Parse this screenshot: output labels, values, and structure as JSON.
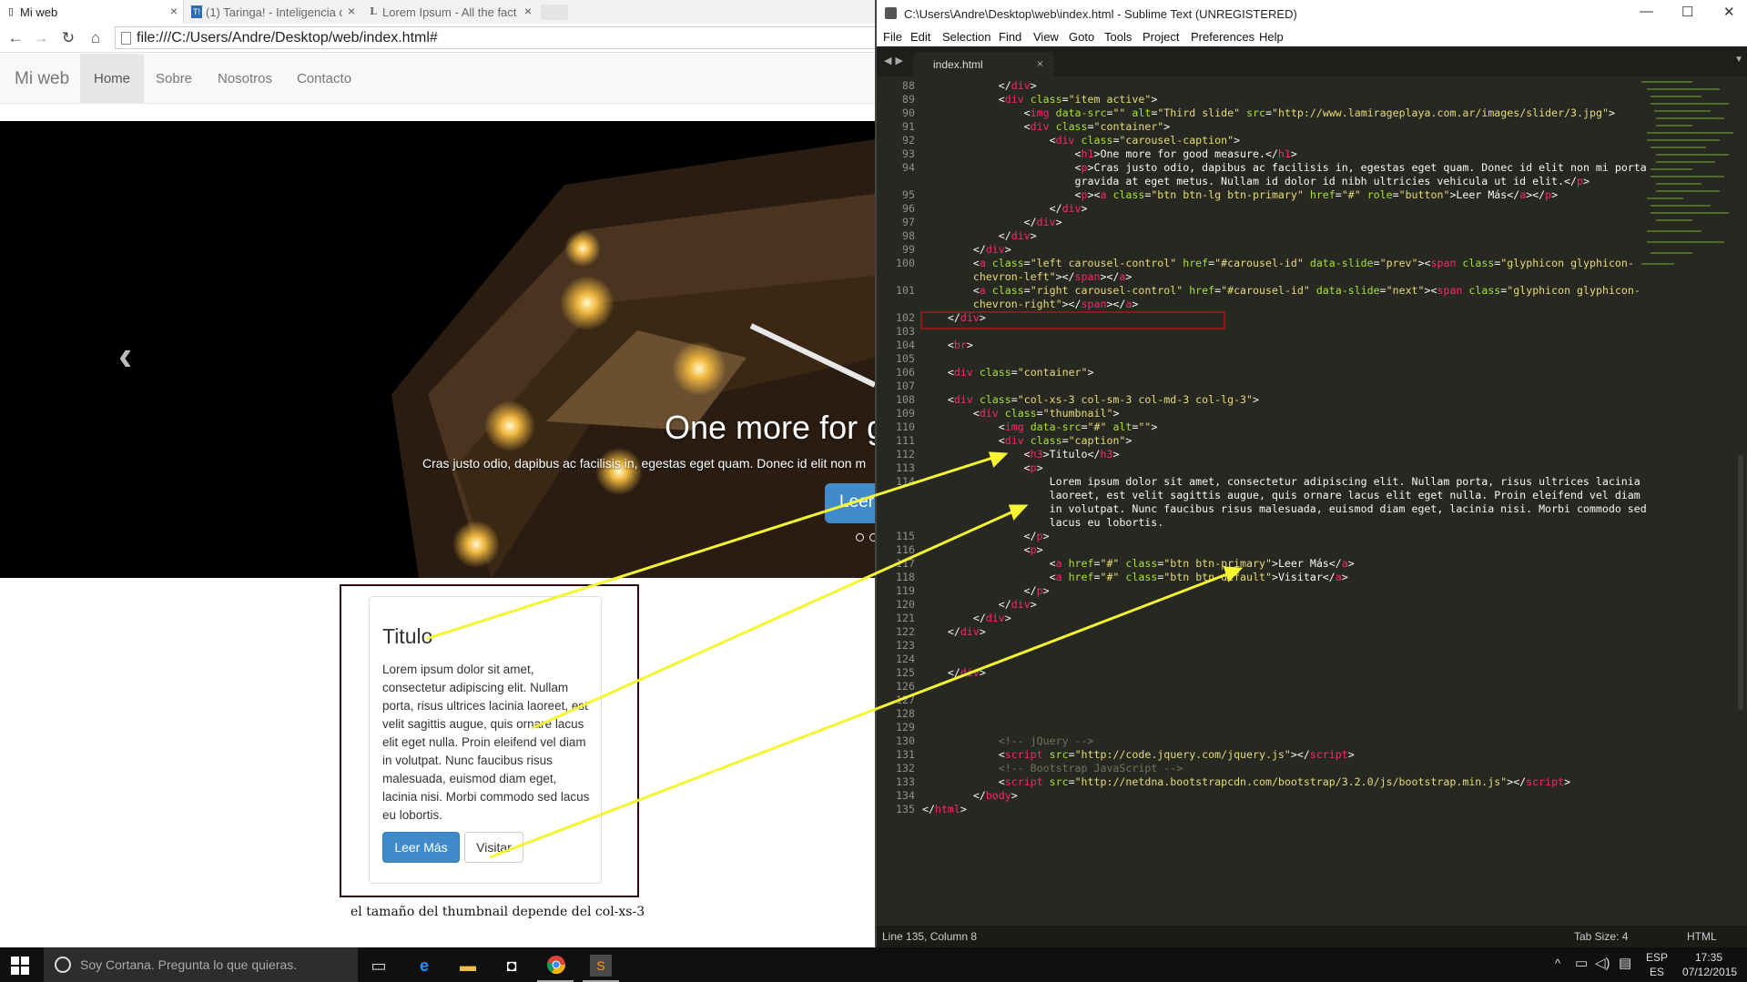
{
  "browser": {
    "tabs": [
      {
        "title": "Mi web",
        "active": true
      },
      {
        "title": "(1) Taringa! - Inteligencia c",
        "active": false
      },
      {
        "title": "Lorem Ipsum - All the fact",
        "active": false
      }
    ],
    "url": "file:///C:/Users/Andre/Desktop/web/index.html#",
    "navbar": {
      "brand": "Mi web",
      "links": [
        "Home",
        "Sobre",
        "Nosotros",
        "Contacto"
      ]
    },
    "carousel": {
      "caption_title": "One more for g",
      "caption_text": "Cras justo odio, dapibus ac facilisis in, egestas eget quam. Donec id elit non m",
      "button_label": "Leer"
    },
    "thumbnail": {
      "title": "Titulo",
      "text": "Lorem ipsum dolor sit amet, consectetur adipiscing elit. Nullam porta, risus ultrices lacinia laoreet, est velit sagittis augue, quis ornare lacus elit eget nulla. Proin eleifend vel diam in volutpat. Nunc faucibus risus malesuada, euismod diam eget, lacinia nisi. Morbi commodo sed lacus eu lobortis.",
      "btn_primary": "Leer Más",
      "btn_default": "Visitar"
    },
    "note": "el tamaño del thumbnail depende del col-xs-3"
  },
  "sublime": {
    "title": "C:\\Users\\Andre\\Desktop\\web\\index.html - Sublime Text (UNREGISTERED)",
    "menu": [
      "File",
      "Edit",
      "Selection",
      "Find",
      "View",
      "Goto",
      "Tools",
      "Project",
      "Preferences",
      "Help"
    ],
    "tab": "index.html",
    "status_left": "Line 135, Column 8",
    "status_tab": "Tab Size: 4",
    "status_syntax": "HTML",
    "lines": [
      {
        "n": "88",
        "html": "            &lt;/<span class=t>div</span>&gt;"
      },
      {
        "n": "89",
        "html": "            &lt;<span class=t>div</span> <span class=a>class</span>=<span class=s>\"item active\"</span>&gt;"
      },
      {
        "n": "90",
        "html": "                &lt;<span class=t>img</span> <span class=a>data-src</span>=<span class=s>\"\"</span> <span class=a>alt</span>=<span class=s>\"Third slide\"</span> <span class=a>src</span>=<span class=s>\"http://www.lamirageplaya.com.ar/images/slider/3.jpg\"</span>&gt;"
      },
      {
        "n": "91",
        "html": "                &lt;<span class=t>div</span> <span class=a>class</span>=<span class=s>\"container\"</span>&gt;"
      },
      {
        "n": "92",
        "html": "                    &lt;<span class=t>div</span> <span class=a>class</span>=<span class=s>\"carousel-caption\"</span>&gt;"
      },
      {
        "n": "93",
        "html": "                        &lt;<span class=t>h1</span>&gt;One more for good measure.&lt;/<span class=t>h1</span>&gt;"
      },
      {
        "n": "94",
        "html": "                        &lt;<span class=t>p</span>&gt;Cras justo odio, dapibus ac facilisis in, egestas eget quam. Donec id elit non mi porta"
      },
      {
        "n": "",
        "html": "                        gravida at eget metus. Nullam id dolor id nibh ultricies vehicula ut id elit.&lt;/<span class=t>p</span>&gt;"
      },
      {
        "n": "95",
        "html": "                        &lt;<span class=t>p</span>&gt;&lt;<span class=t>a</span> <span class=a>class</span>=<span class=s>\"btn btn-lg btn-primary\"</span> <span class=a>href</span>=<span class=s>\"#\"</span> <span class=a>role</span>=<span class=s>\"button\"</span>&gt;Leer Más&lt;/<span class=t>a</span>&gt;&lt;/<span class=t>p</span>&gt;"
      },
      {
        "n": "96",
        "html": "                    &lt;/<span class=t>div</span>&gt;"
      },
      {
        "n": "97",
        "html": "                &lt;/<span class=t>div</span>&gt;"
      },
      {
        "n": "98",
        "html": "            &lt;/<span class=t>div</span>&gt;"
      },
      {
        "n": "99",
        "html": "        &lt;/<span class=t>div</span>&gt;"
      },
      {
        "n": "100",
        "html": "        &lt;<span class=t>a</span> <span class=a>class</span>=<span class=s>\"left carousel-control\"</span> <span class=a>href</span>=<span class=s>\"#carousel-id\"</span> <span class=a>data-slide</span>=<span class=s>\"prev\"</span>&gt;&lt;<span class=t>span</span> <span class=a>class</span>=<span class=s>\"glyphicon glyphicon-</span>"
      },
      {
        "n": "",
        "html": "        <span class=s>chevron-left\"</span>&gt;&lt;/<span class=t>span</span>&gt;&lt;/<span class=t>a</span>&gt;"
      },
      {
        "n": "101",
        "html": "        &lt;<span class=t>a</span> <span class=a>class</span>=<span class=s>\"right carousel-control\"</span> <span class=a>href</span>=<span class=s>\"#carousel-id\"</span> <span class=a>data-slide</span>=<span class=s>\"next\"</span>&gt;&lt;<span class=t>span</span> <span class=a>class</span>=<span class=s>\"glyphicon glyphicon-</span>"
      },
      {
        "n": "",
        "html": "        <span class=s>chevron-right\"</span>&gt;&lt;/<span class=t>span</span>&gt;&lt;/<span class=t>a</span>&gt;"
      },
      {
        "n": "102",
        "html": "    &lt;/<span class=t>div</span>&gt;"
      },
      {
        "n": "103",
        "html": ""
      },
      {
        "n": "104",
        "html": "    &lt;<span class=t>br</span>&gt;"
      },
      {
        "n": "105",
        "html": ""
      },
      {
        "n": "106",
        "html": "    &lt;<span class=t>div</span> <span class=a>class</span>=<span class=s>\"container\"</span>&gt;"
      },
      {
        "n": "107",
        "html": ""
      },
      {
        "n": "108",
        "html": "    &lt;<span class=t>div</span> <span class=a>class</span>=<span class=s>\"col-xs-3 col-sm-3 col-md-3 col-lg-3\"</span>&gt;"
      },
      {
        "n": "109",
        "html": "        &lt;<span class=t>div</span> <span class=a>class</span>=<span class=s>\"thumbnail\"</span>&gt;"
      },
      {
        "n": "110",
        "html": "            &lt;<span class=t>img</span> <span class=a>data-src</span>=<span class=s>\"#\"</span> <span class=a>alt</span>=<span class=s>\"\"</span>&gt;"
      },
      {
        "n": "111",
        "html": "            &lt;<span class=t>div</span> <span class=a>class</span>=<span class=s>\"caption\"</span>&gt;"
      },
      {
        "n": "112",
        "html": "                &lt;<span class=t>h3</span>&gt;Titulo&lt;/<span class=t>h3</span>&gt;"
      },
      {
        "n": "113",
        "html": "                &lt;<span class=t>p</span>&gt;"
      },
      {
        "n": "114",
        "html": "                    Lorem ipsum dolor sit amet, consectetur adipiscing elit. Nullam porta, risus ultrices lacinia"
      },
      {
        "n": "",
        "html": "                    laoreet, est velit sagittis augue, quis ornare lacus elit eget nulla. Proin eleifend vel diam"
      },
      {
        "n": "",
        "html": "                    in volutpat. Nunc faucibus risus malesuada, euismod diam eget, lacinia nisi. Morbi commodo sed"
      },
      {
        "n": "",
        "html": "                    lacus eu lobortis."
      },
      {
        "n": "115",
        "html": "                &lt;/<span class=t>p</span>&gt;"
      },
      {
        "n": "116",
        "html": "                &lt;<span class=t>p</span>&gt;"
      },
      {
        "n": "117",
        "html": "                    &lt;<span class=t>a</span> <span class=a>href</span>=<span class=s>\"#\"</span> <span class=a>class</span>=<span class=s>\"btn btn-primary\"</span>&gt;Leer Más&lt;/<span class=t>a</span>&gt;"
      },
      {
        "n": "118",
        "html": "                    &lt;<span class=t>a</span> <span class=a>href</span>=<span class=s>\"#\"</span> <span class=a>class</span>=<span class=s>\"btn btn-default\"</span>&gt;Visitar&lt;/<span class=t>a</span>&gt;"
      },
      {
        "n": "119",
        "html": "                &lt;/<span class=t>p</span>&gt;"
      },
      {
        "n": "120",
        "html": "            &lt;/<span class=t>div</span>&gt;"
      },
      {
        "n": "121",
        "html": "        &lt;/<span class=t>div</span>&gt;"
      },
      {
        "n": "122",
        "html": "    &lt;/<span class=t>div</span>&gt;"
      },
      {
        "n": "123",
        "html": ""
      },
      {
        "n": "124",
        "html": ""
      },
      {
        "n": "125",
        "html": "    &lt;/<span class=t>div</span>&gt;"
      },
      {
        "n": "126",
        "html": ""
      },
      {
        "n": "127",
        "html": ""
      },
      {
        "n": "128",
        "html": ""
      },
      {
        "n": "129",
        "html": ""
      },
      {
        "n": "130",
        "html": "            <span class=c>&lt;!-- jQuery --&gt;</span>"
      },
      {
        "n": "131",
        "html": "            &lt;<span class=t>script</span> <span class=a>src</span>=<span class=s>\"http://code.jquery.com/jquery.js\"</span>&gt;&lt;/<span class=t>script</span>&gt;"
      },
      {
        "n": "132",
        "html": "            <span class=c>&lt;!-- Bootstrap JavaScript --&gt;</span>"
      },
      {
        "n": "133",
        "html": "            &lt;<span class=t>script</span> <span class=a>src</span>=<span class=s>\"http://netdna.bootstrapcdn.com/bootstrap/3.2.0/js/bootstrap.min.js\"</span>&gt;&lt;/<span class=t>script</span>&gt;"
      },
      {
        "n": "134",
        "html": "        &lt;/<span class=t>body</span>&gt;"
      },
      {
        "n": "135",
        "html": "&lt;/<span class=t>html</span>&gt;"
      }
    ]
  },
  "taskbar": {
    "search_placeholder": "Soy Cortana. Pregunta lo que quieras.",
    "lang_top": "ESP",
    "lang_bottom": "ES",
    "time": "17:35",
    "date": "07/12/2015"
  },
  "colors": {
    "arrow": "#f5f532",
    "bootstrap_primary": "#428bca",
    "sublime_bg": "#272822"
  }
}
